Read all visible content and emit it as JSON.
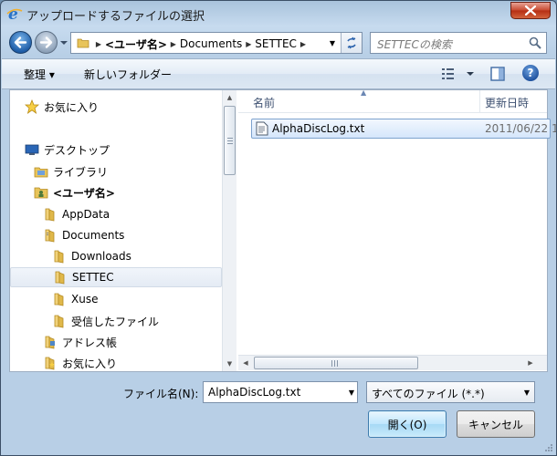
{
  "window": {
    "title": "アップロードするファイルの選択",
    "close_label": "✕"
  },
  "address": {
    "crumbs": [
      "<ユーザ名>",
      "Documents",
      "SETTEC"
    ]
  },
  "search": {
    "placeholder": "SETTECの検索"
  },
  "toolbar": {
    "organize_label": "整理 ▾",
    "new_folder_label": "新しいフォルダー",
    "help_label": "?"
  },
  "nav": {
    "items": [
      {
        "label": "お気に入り",
        "icon": "star-icon"
      },
      {
        "label": "デスクトップ",
        "icon": "desktop-icon"
      },
      {
        "label": "ライブラリ",
        "icon": "library-icon"
      },
      {
        "label": "<ユーザ名>",
        "icon": "user-folder-icon"
      },
      {
        "label": "AppData",
        "icon": "folder-icon"
      },
      {
        "label": "Documents",
        "icon": "folder-icon"
      },
      {
        "label": "Downloads",
        "icon": "folder-icon"
      },
      {
        "label": "SETTEC",
        "icon": "folder-icon"
      },
      {
        "label": "Xuse",
        "icon": "folder-icon"
      },
      {
        "label": "受信したファイル",
        "icon": "folder-icon"
      },
      {
        "label": "アドレス帳",
        "icon": "contacts-icon"
      },
      {
        "label": "お気に入り",
        "icon": "favorites-folder-icon"
      }
    ]
  },
  "files": {
    "columns": {
      "name": "名前",
      "date": "更新日時"
    },
    "rows": [
      {
        "name": "AlphaDiscLog.txt",
        "date": "2011/06/22 1"
      }
    ]
  },
  "bottom": {
    "filename_label": "ファイル名(N):",
    "filename_value": "AlphaDiscLog.txt",
    "filetype_value": "すべてのファイル (*.*)",
    "open_label": "開く(O)",
    "cancel_label": "キャンセル"
  },
  "colors": {
    "accent": "#1f5ea8",
    "close": "#c7472d",
    "selection": "#d5e6fb"
  }
}
